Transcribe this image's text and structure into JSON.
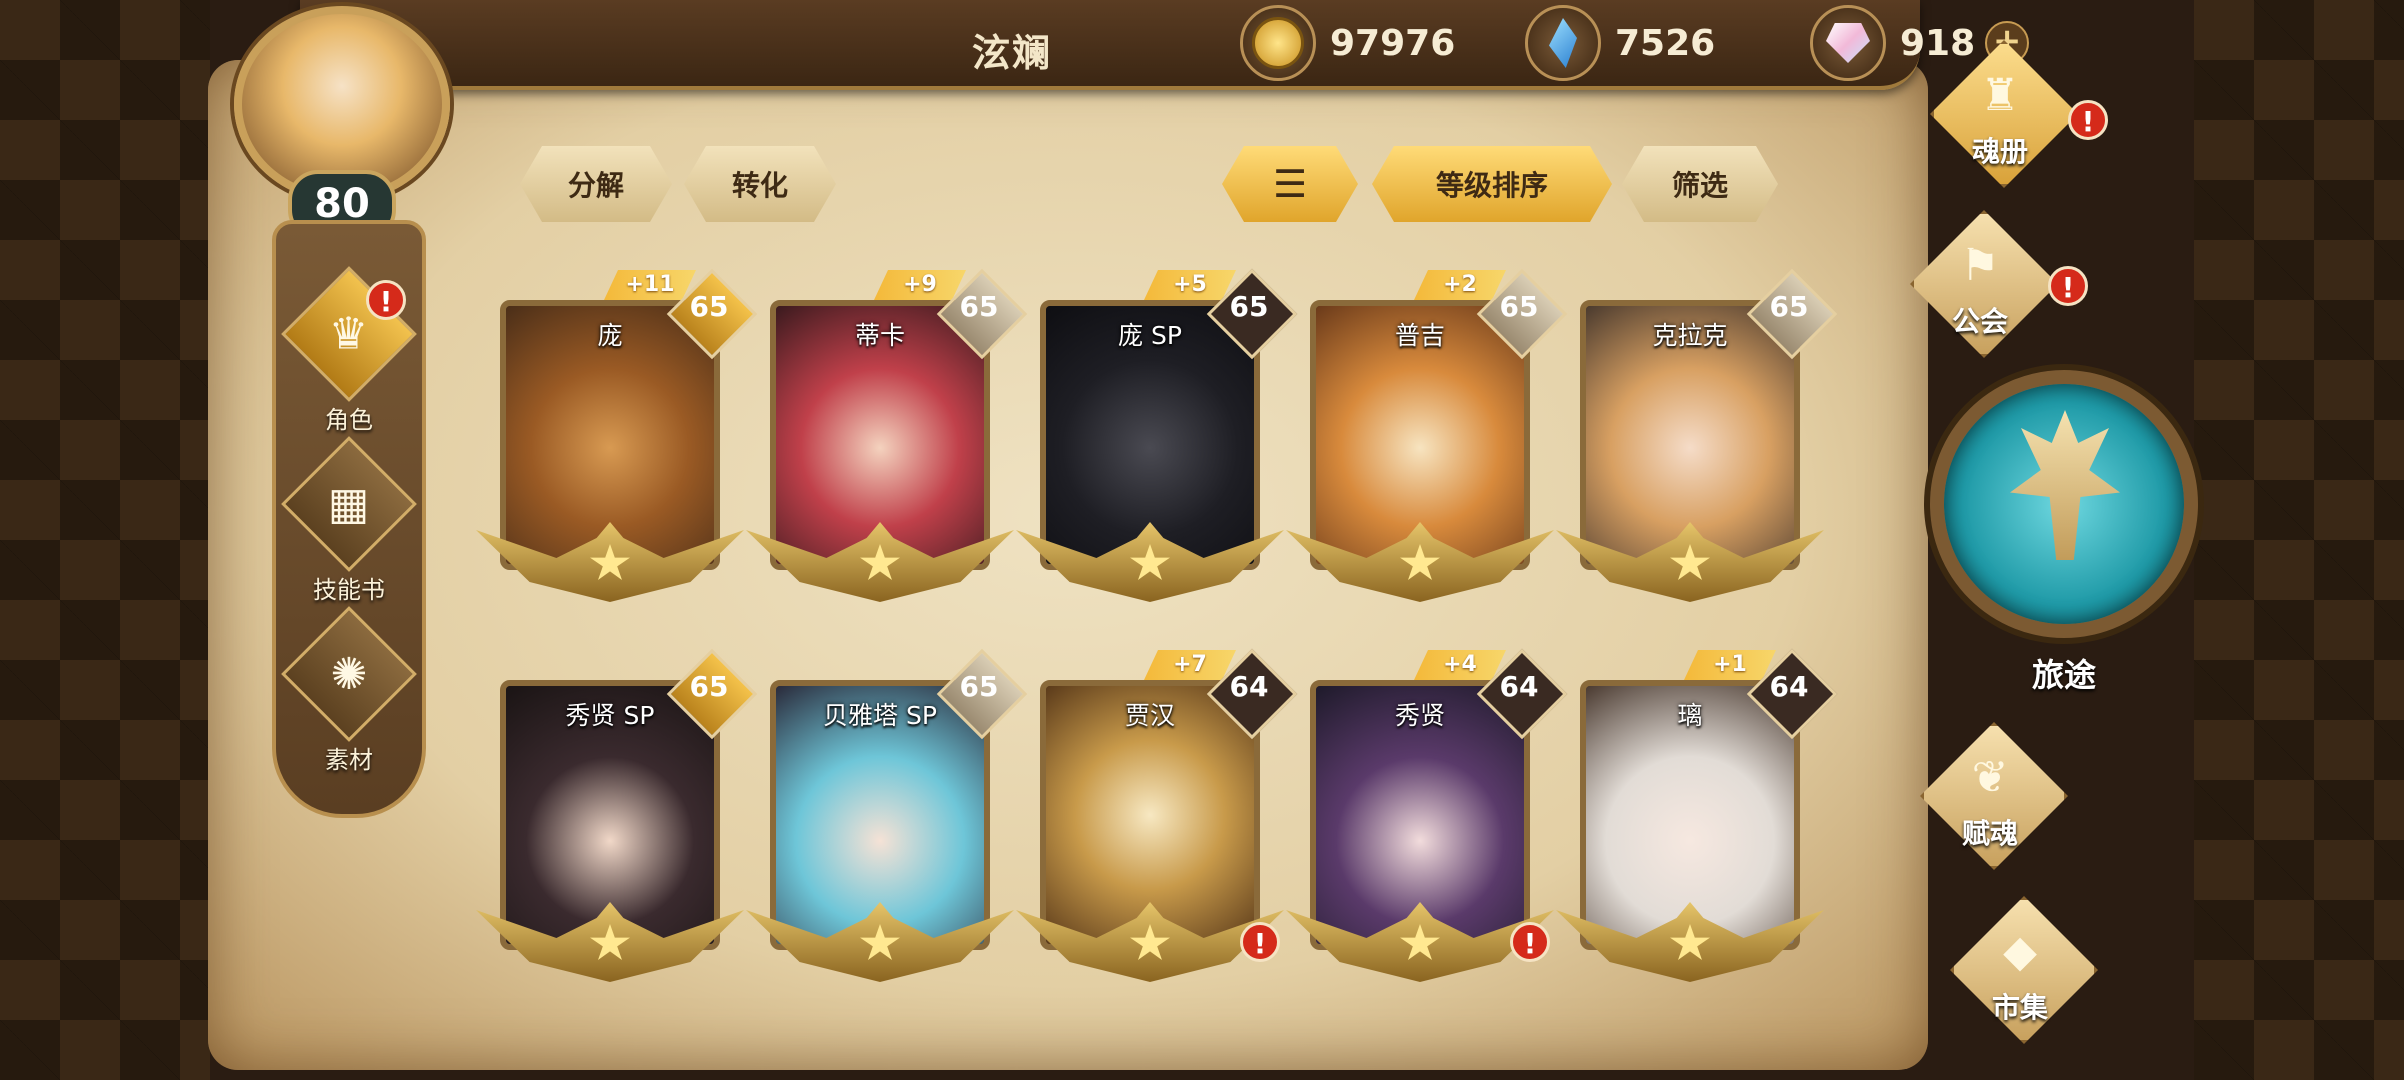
{
  "header": {
    "player_name": "泫斓",
    "player_level": "80",
    "currencies": [
      {
        "name": "gold-coin",
        "value": "97976"
      },
      {
        "name": "blue-crystal",
        "value": "7526"
      },
      {
        "name": "pink-gem",
        "value": "918"
      }
    ],
    "plus_label": "+"
  },
  "left_nav": [
    {
      "label": "角色",
      "icon": "helmet-icon",
      "active": true,
      "alert": true
    },
    {
      "label": "技能书",
      "icon": "skill-book-icon",
      "active": false,
      "alert": false
    },
    {
      "label": "素材",
      "icon": "material-icon",
      "active": false,
      "alert": false
    }
  ],
  "toolbar": {
    "decompose": "分解",
    "convert": "转化",
    "sort_icon": "sort-icon",
    "sort_by_level": "等级排序",
    "filter": "筛选"
  },
  "cards": [
    {
      "name": "庞",
      "level": "65",
      "bonus": "+11",
      "level_style": "gold",
      "alert": false,
      "art": "tiger"
    },
    {
      "name": "蒂卡",
      "level": "65",
      "bonus": "+9",
      "level_style": "light",
      "alert": false,
      "art": "red-hair-girl"
    },
    {
      "name": "庞 SP",
      "level": "65",
      "bonus": "+5",
      "level_style": "dark",
      "alert": false,
      "art": "black-panther"
    },
    {
      "name": "普吉",
      "level": "65",
      "bonus": "+2",
      "level_style": "light",
      "alert": false,
      "art": "owl"
    },
    {
      "name": "克拉克",
      "level": "65",
      "bonus": "",
      "level_style": "light",
      "alert": false,
      "art": "glasses-girl"
    },
    {
      "name": "秀贤 SP",
      "level": "65",
      "bonus": "",
      "level_style": "gold",
      "alert": false,
      "art": "dark-hair-girl"
    },
    {
      "name": "贝雅塔 SP",
      "level": "65",
      "bonus": "",
      "level_style": "light",
      "alert": false,
      "art": "blue-hair-girl"
    },
    {
      "name": "贾汉",
      "level": "64",
      "bonus": "+7",
      "level_style": "dark",
      "alert": true,
      "art": "masked-warrior"
    },
    {
      "name": "秀贤",
      "level": "64",
      "bonus": "+4",
      "level_style": "dark",
      "alert": true,
      "art": "purple-hair-girl"
    },
    {
      "name": "璃",
      "level": "64",
      "bonus": "+1",
      "level_style": "dark",
      "alert": false,
      "art": "white-hair-girl"
    }
  ],
  "right_nav": {
    "soul_book": "魂册",
    "guild": "公会",
    "journey": "旅途",
    "soul_grant": "赋魂",
    "market": "市集"
  },
  "colors": {
    "accent_gold": "#f2c24e",
    "alert_red": "#d52a1a",
    "journey_teal": "#1f9aa7"
  }
}
